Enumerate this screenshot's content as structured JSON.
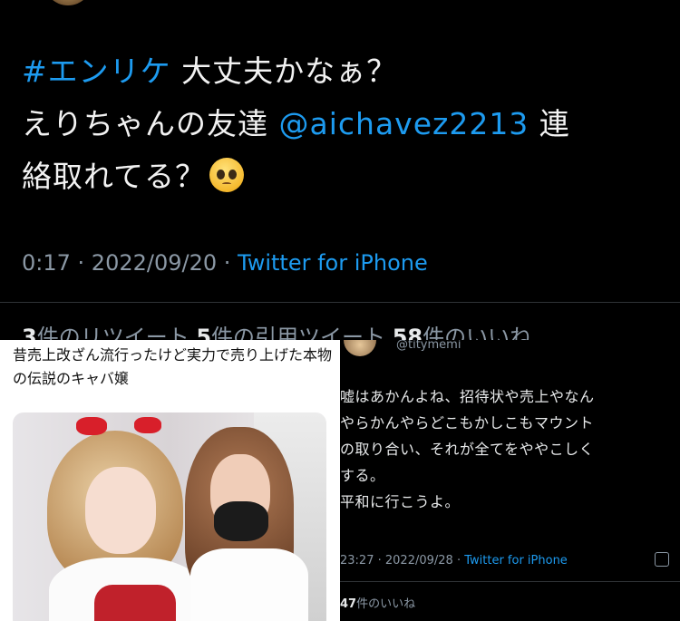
{
  "top_tweet": {
    "hashtag": "#エンリケ",
    "line1_rest": " 大丈夫かなぁ？",
    "line2_prefix": "えりちゃんの友達 ",
    "mention": "@aichavez2213",
    "line2_suffix": " 連",
    "line3": "絡取れてる？",
    "emoji": "pleading-face-icon",
    "time": "0:17",
    "sep": " · ",
    "date": "2022/09/20",
    "sep2": " · ",
    "via": "Twitter for iPhone",
    "stats": {
      "retweets_count": "3",
      "retweets_label": "件のリツイート",
      "quotes_count": "5",
      "quotes_label": "件の引用ツイート",
      "likes_count": "58",
      "likes_label": "件のいいね"
    }
  },
  "photo_card": {
    "caption": "昔売上改ざん流行ったけど実力で売り上げた本物の伝説のキャバ嬢"
  },
  "quoted_tweet": {
    "handle": "@titymemi",
    "text_lines": [
      "嘘はあかんよね、招待状や売上やなん",
      "やらかんやらどこもかしこもマウント",
      "の取り合い、それが全てをややこしく",
      "する。",
      "平和に行こうよ。"
    ],
    "time": "23:27",
    "sep": " · ",
    "date": "2022/09/28",
    "sep2": " · ",
    "via": "Twitter for iPhone",
    "likes_count": "47",
    "likes_label": "件のいいね"
  },
  "colors": {
    "background": "#000000",
    "link": "#1d9bf0",
    "muted": "#8b98a5",
    "text": "#e7e9ea"
  }
}
